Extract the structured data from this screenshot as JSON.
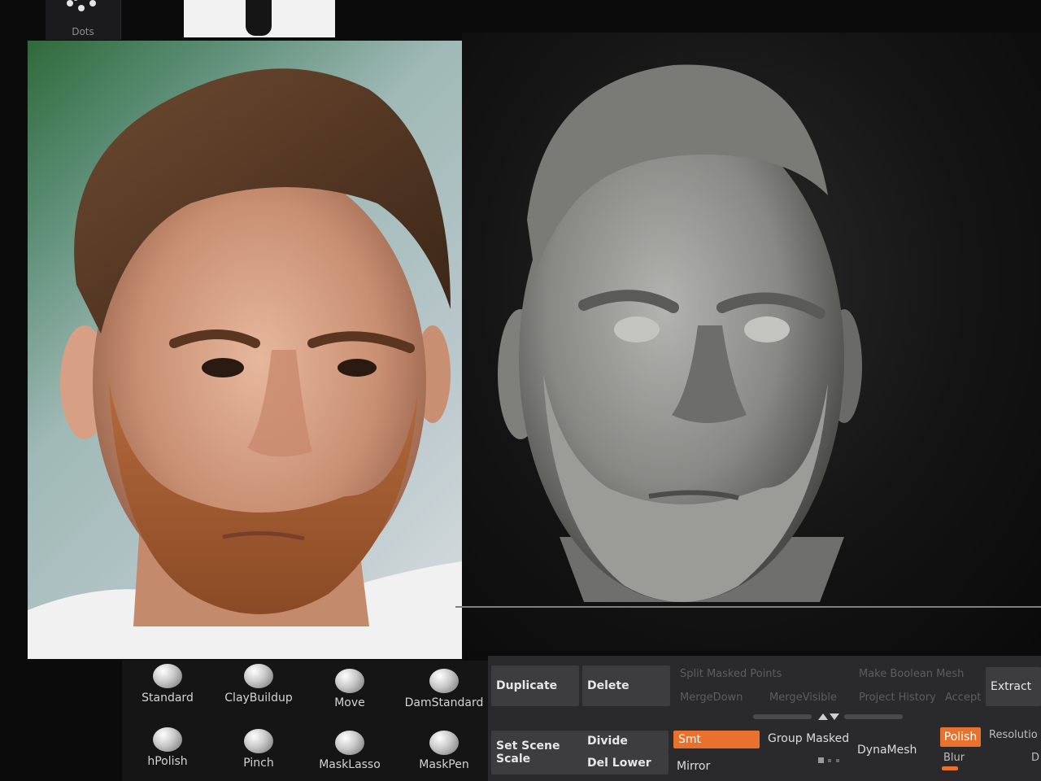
{
  "brushes": {
    "dots_label": "Dots",
    "row1": [
      "Standard",
      "ClayBuildup",
      "Move",
      "DamStandard"
    ],
    "row2": [
      "hPolish",
      "Pinch",
      "MaskLasso",
      "MaskPen"
    ]
  },
  "subtool": {
    "duplicate": "Duplicate",
    "delete": "Delete",
    "split_masked_points": "Split Masked Points",
    "merge_down": "MergeDown",
    "merge_visible": "MergeVisible",
    "make_boolean_mesh": "Make Boolean Mesh",
    "project_history": "Project History",
    "accept": "Accept",
    "extract": "Extract",
    "set_scene_scale": "Set Scene Scale",
    "divide": "Divide",
    "del_lower": "Del Lower",
    "smt": "Smt",
    "group_masked": "Group Masked",
    "mirror": "Mirror",
    "dynamesh": "DynaMesh",
    "polish": "Polish",
    "resolution": "Resolutio",
    "blur": "Blur",
    "d": "D"
  },
  "colors": {
    "accent": "#e8712d",
    "panel": "#2a2a2c",
    "button": "#3d3d40"
  }
}
